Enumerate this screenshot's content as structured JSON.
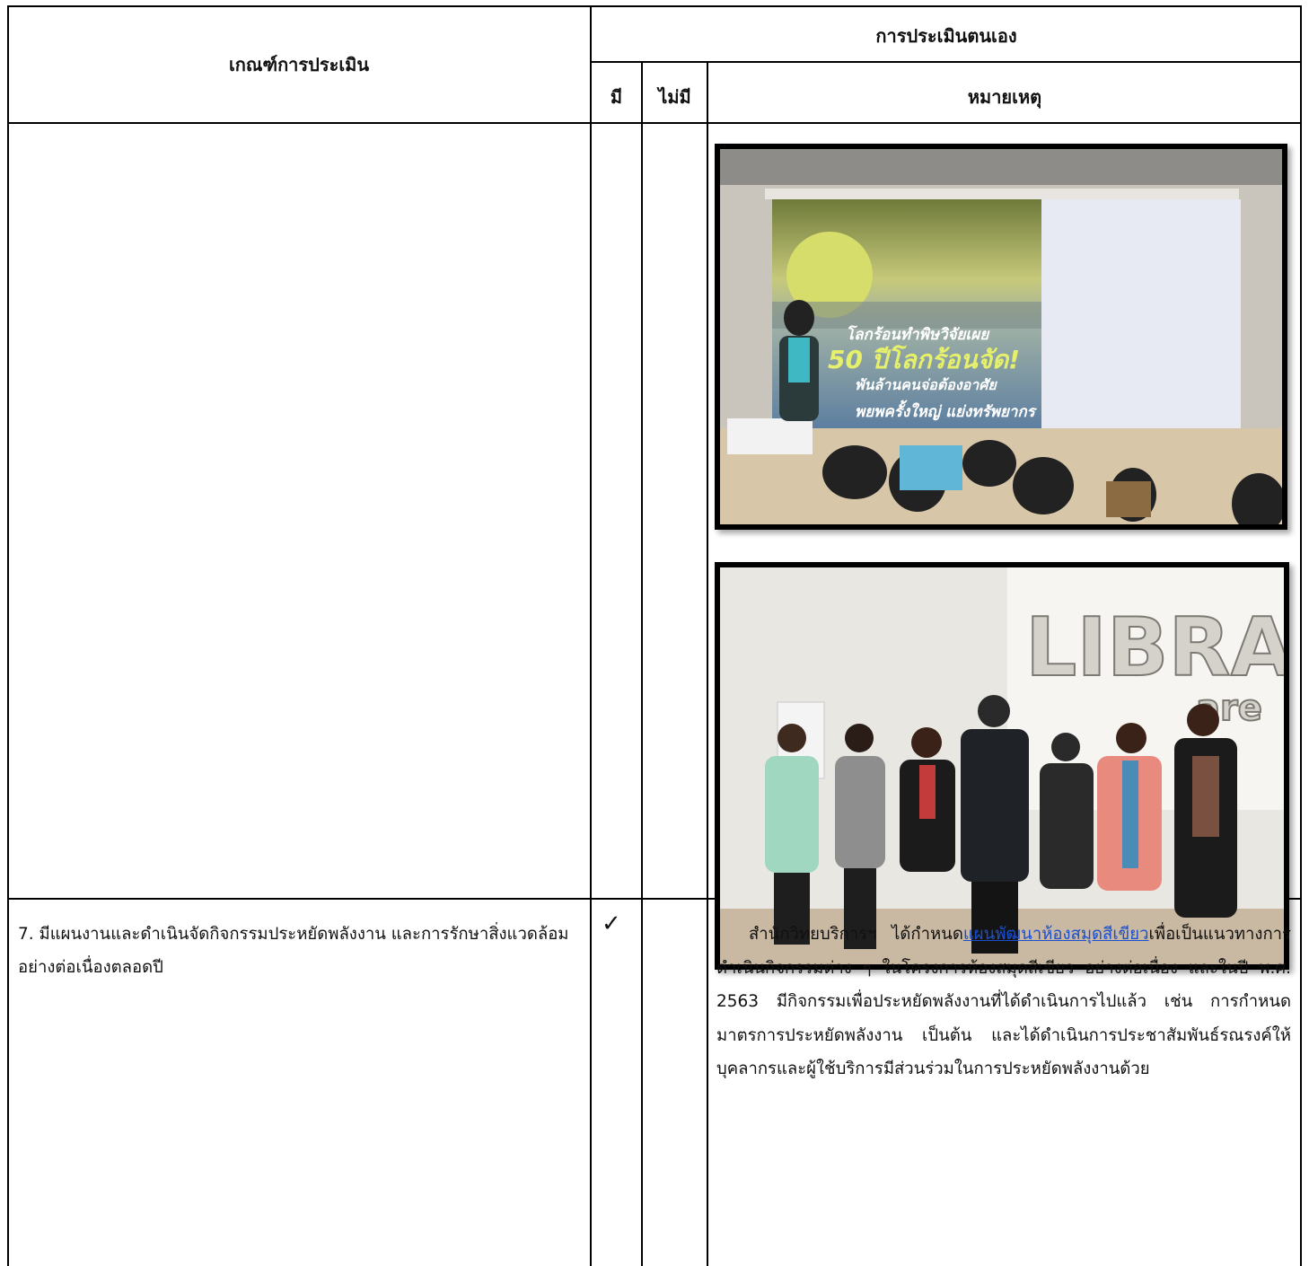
{
  "header": {
    "criteria": "เกณฑ์การประเมิน",
    "self_assessment": "การประเมินตนเอง",
    "yes": "มี",
    "no": "ไม่มี",
    "remarks": "หมายเหตุ"
  },
  "photos": [
    {
      "type": "presentation",
      "slide_text": [
        "โลกร้อนทำพิษวิจัยเผย",
        "50 ปีโลกร้อนจัด!",
        "พันล้านคนจ่อต้องอาศัย",
        "พยพครั้งใหญ่ แย่งทรัพยากร"
      ]
    },
    {
      "type": "group-photo",
      "banner_text": "LIBRA",
      "banner_sub": "are"
    }
  ],
  "row7": {
    "criteria": "7. มีแผนงานและดำเนินจัดกิจกรรมประหยัดพลังงาน และการรักษาสิ่งแวดล้อม อย่างต่อเนื่องตลอดปี",
    "check": "✓",
    "note_prefix": "สำนักวิทยบริการฯ ได้กำหนด",
    "note_link": "แผนพัฒนาห้องสมุดสีเขียว",
    "note_suffix": "เพื่อเป็นแนวทางการดำเนินกิจกรรมต่าง ๆ ในโครงการห้องสมุดสีเขียว อย่างต่อเนื่อง และในปี พ.ศ. 2563 มีกิจกรรมเพื่อประหยัดพลังงานที่ได้ดำเนินการไปแล้ว เช่น การกำหนดมาตรการประหยัดพลังงาน เป็นต้น และได้ดำเนินการประชาสัมพันธ์รณรงค์ให้บุคลากรและผู้ใช้บริการมีส่วนร่วมในการประหยัดพลังงานด้วย"
  }
}
